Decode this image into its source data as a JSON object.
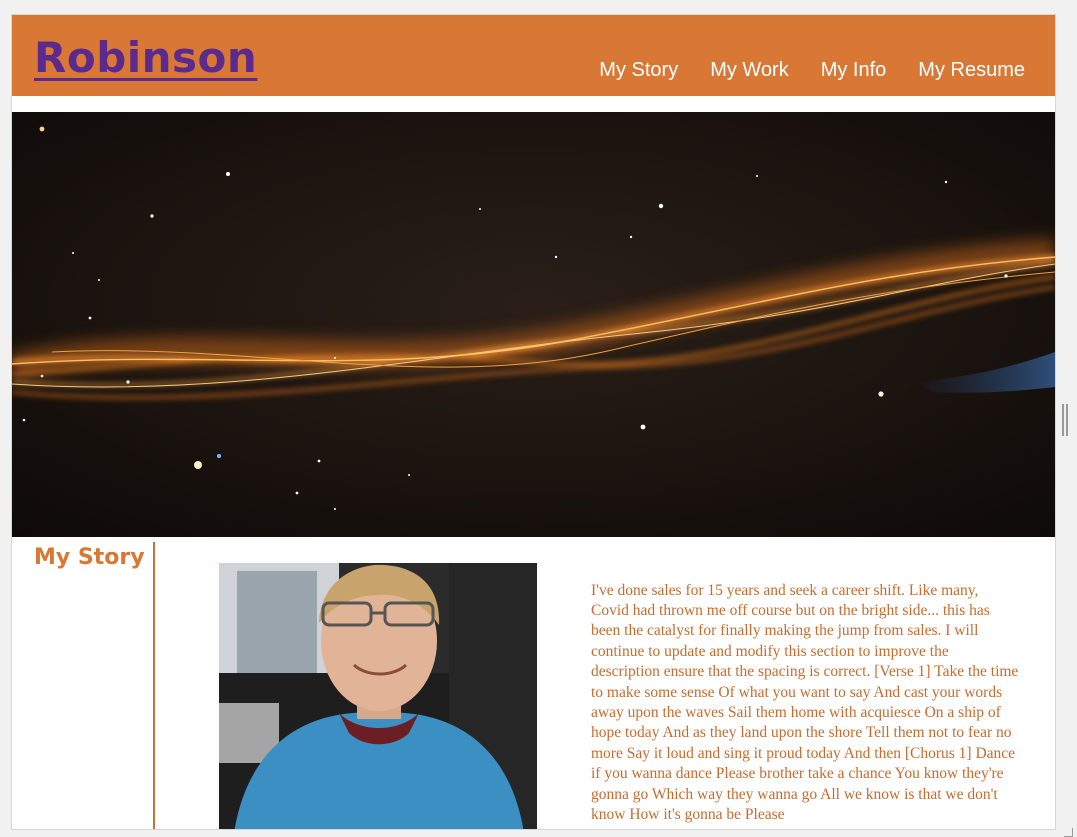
{
  "site": {
    "brand": "Robinson",
    "nav": [
      "My Story",
      "My Work",
      "My Info",
      "My Resume"
    ]
  },
  "hero": {
    "image": "night sky with glowing orange light streaks"
  },
  "story": {
    "heading": "My Story",
    "portrait": "photo of smiling man with glasses in blue hoodie",
    "text": "I've done sales for 15 years and seek a career shift. Like many, Covid had thrown me off course but on the bright side... this has been the catalyst for finally making the jump from sales. I will continue to update and modify this section to improve the description ensure that the spacing is correct. [Verse 1] Take the time to make some sense Of what you want to say And cast your words away upon the waves Sail them home with acquiesce On a ship of hope today And as they land upon the shore Tell them not to fear no more Say it loud and sing it proud today And then [Chorus 1] Dance if you wanna dance Please brother take a chance You know they're gonna go Which way they wanna go All we know is that we don't know How it's gonna be Please"
  },
  "colors": {
    "accent": "#d97835",
    "brand_link": "#5b2a8c",
    "text": "#c86b2c"
  }
}
